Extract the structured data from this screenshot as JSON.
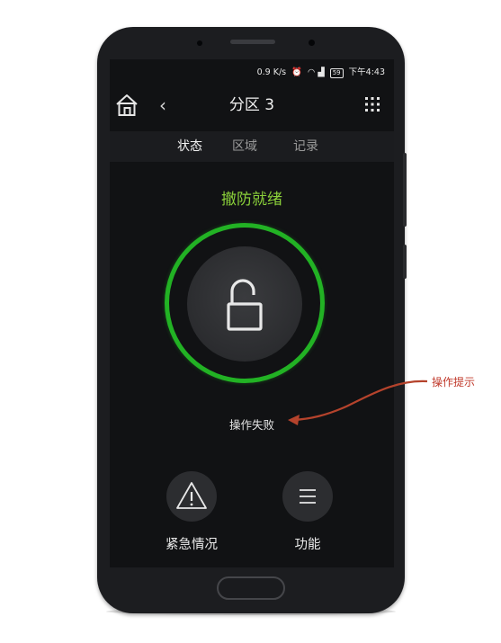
{
  "status_bar": {
    "speed": "0.9 K/s",
    "battery": "59",
    "time": "下午4:43"
  },
  "header": {
    "title": "分区 3",
    "back_glyph": "‹"
  },
  "tabs": [
    {
      "label": "状态",
      "active": true
    },
    {
      "label": "区域",
      "active": false
    },
    {
      "label": "记录",
      "active": false
    }
  ],
  "main": {
    "state_label": "撤防就绪",
    "result_label": "操作失败"
  },
  "bottom_buttons": [
    {
      "label": "紧急情况",
      "icon": "warning-icon"
    },
    {
      "label": "功能",
      "icon": "menu-icon"
    }
  ],
  "annotation": {
    "label": "操作提示"
  },
  "colors": {
    "accent_green": "#22b224",
    "state_green": "#8bd13a",
    "annotation_red": "#c0392b"
  }
}
